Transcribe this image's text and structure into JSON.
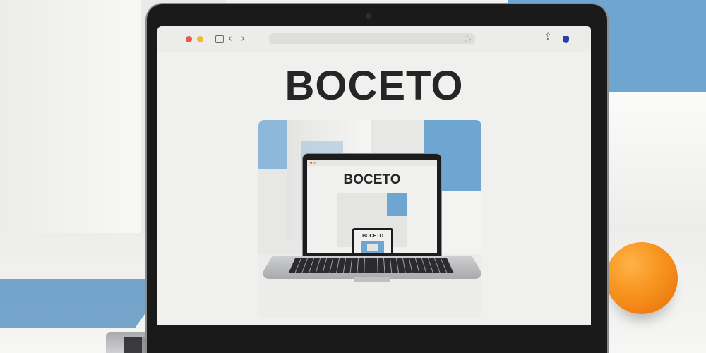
{
  "browser": {
    "nav_back_glyph": "‹",
    "nav_forward_glyph": "›",
    "share_glyph": "⇪",
    "refresh_glyph": "◌"
  },
  "page": {
    "title": "BOCETO"
  },
  "hero": {
    "nested_title": "BOCETO",
    "nested_nested_title": "BOCETO"
  },
  "colors": {
    "accent_blue": "#6ea6d1",
    "traffic_red": "#f0564c",
    "traffic_yellow": "#f5b833",
    "orange": "#f7931e",
    "title_text": "#262626"
  }
}
